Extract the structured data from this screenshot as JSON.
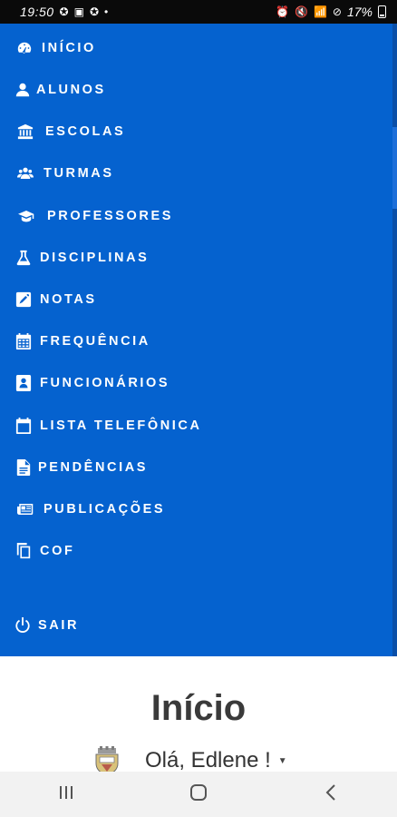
{
  "status_bar": {
    "time": "19:50",
    "battery": "17%"
  },
  "menu": {
    "items": [
      {
        "label": "INÍCIO",
        "icon": "tachometer-icon"
      },
      {
        "label": "ALUNOS",
        "icon": "user-icon"
      },
      {
        "label": "ESCOLAS",
        "icon": "institution-icon"
      },
      {
        "label": "TURMAS",
        "icon": "users-icon"
      },
      {
        "label": "PROFESSORES",
        "icon": "graduation-cap-icon"
      },
      {
        "label": "DISCIPLINAS",
        "icon": "flask-icon"
      },
      {
        "label": "NOTAS",
        "icon": "pencil-square-icon"
      },
      {
        "label": "FREQUÊNCIA",
        "icon": "calendar-grid-icon"
      },
      {
        "label": "FUNCIONÁRIOS",
        "icon": "address-book-icon"
      },
      {
        "label": "LISTA TELEFÔNICA",
        "icon": "calendar-icon"
      },
      {
        "label": "PENDÊNCIAS",
        "icon": "file-text-icon"
      },
      {
        "label": "PUBLICAÇÕES",
        "icon": "newspaper-icon"
      },
      {
        "label": "COF",
        "icon": "copy-icon"
      }
    ],
    "logout": {
      "label": "SAIR",
      "icon": "power-icon"
    }
  },
  "content": {
    "title": "Início",
    "greeting": "Olá, Edlene !"
  },
  "colors": {
    "drawer_bg": "#0562cf",
    "text_on_drawer": "#ffffff"
  }
}
